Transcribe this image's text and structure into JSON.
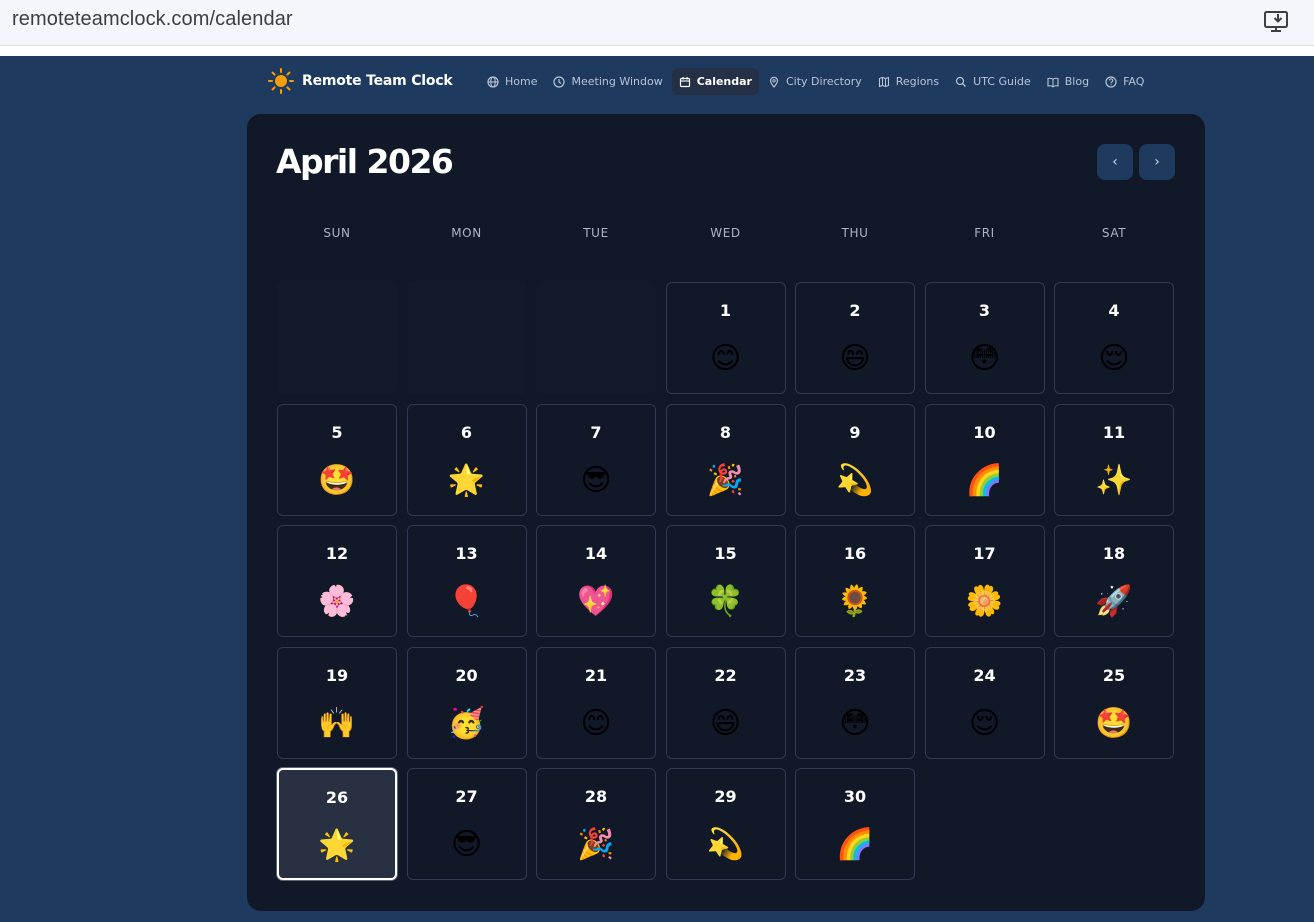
{
  "browser": {
    "url": "remoteteamclock.com/calendar",
    "install_icon": "install-app-icon"
  },
  "nav": {
    "brand": "Remote Team Clock",
    "brand_icon": "sun-icon",
    "links": [
      {
        "label": "Home",
        "icon": "globe-icon",
        "active": false
      },
      {
        "label": "Meeting Window",
        "icon": "clock-icon",
        "active": false
      },
      {
        "label": "Calendar",
        "icon": "calendar-icon",
        "active": true
      },
      {
        "label": "City Directory",
        "icon": "map-pin-icon",
        "active": false
      },
      {
        "label": "Regions",
        "icon": "map-icon",
        "active": false
      },
      {
        "label": "UTC Guide",
        "icon": "search-icon",
        "active": false
      },
      {
        "label": "Blog",
        "icon": "book-icon",
        "active": false
      },
      {
        "label": "FAQ",
        "icon": "help-circle-icon",
        "active": false
      }
    ]
  },
  "calendar": {
    "month_title": "April 2026",
    "prev_label": "‹",
    "next_label": "›",
    "weekdays": [
      "SUN",
      "MON",
      "TUE",
      "WED",
      "THU",
      "FRI",
      "SAT"
    ],
    "leading_empty": 3,
    "today": 26,
    "days": [
      {
        "day": "1",
        "emoji": "😊"
      },
      {
        "day": "2",
        "emoji": "😄"
      },
      {
        "day": "3",
        "emoji": "😳"
      },
      {
        "day": "4",
        "emoji": "😌"
      },
      {
        "day": "5",
        "emoji": "🤩"
      },
      {
        "day": "6",
        "emoji": "🌟"
      },
      {
        "day": "7",
        "emoji": "😎"
      },
      {
        "day": "8",
        "emoji": "🎉"
      },
      {
        "day": "9",
        "emoji": "💫"
      },
      {
        "day": "10",
        "emoji": "🌈"
      },
      {
        "day": "11",
        "emoji": "✨"
      },
      {
        "day": "12",
        "emoji": "🌸"
      },
      {
        "day": "13",
        "emoji": "🎈"
      },
      {
        "day": "14",
        "emoji": "💖"
      },
      {
        "day": "15",
        "emoji": "🍀"
      },
      {
        "day": "16",
        "emoji": "🌻"
      },
      {
        "day": "17",
        "emoji": "🌼"
      },
      {
        "day": "18",
        "emoji": "🚀"
      },
      {
        "day": "19",
        "emoji": "🙌"
      },
      {
        "day": "20",
        "emoji": "🥳"
      },
      {
        "day": "21",
        "emoji": "😊"
      },
      {
        "day": "22",
        "emoji": "😄"
      },
      {
        "day": "23",
        "emoji": "😳"
      },
      {
        "day": "24",
        "emoji": "😌"
      },
      {
        "day": "25",
        "emoji": "🤩"
      },
      {
        "day": "26",
        "emoji": "🌟"
      },
      {
        "day": "27",
        "emoji": "😎"
      },
      {
        "day": "28",
        "emoji": "🎉"
      },
      {
        "day": "29",
        "emoji": "💫"
      },
      {
        "day": "30",
        "emoji": "🌈"
      }
    ]
  },
  "colors": {
    "page_bg": "#1e3a5f",
    "card_bg": "#111827",
    "cell_border": "#2f3b52",
    "today_bg": "#283141",
    "accent_sun": "#f59e0b"
  }
}
